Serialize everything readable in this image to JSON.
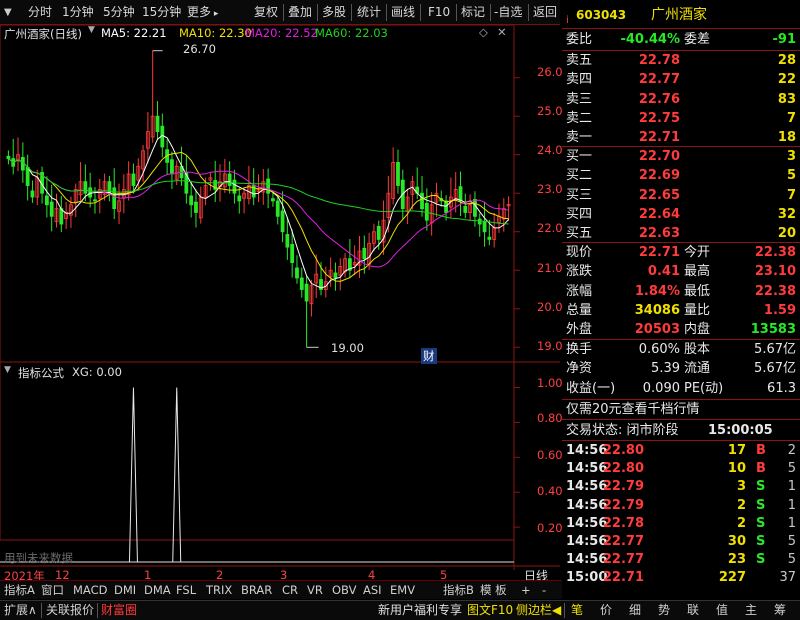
{
  "toolbar": {
    "back_icon": "down-triangle-icon",
    "timeframes": [
      "分时",
      "1分钟",
      "5分钟",
      "15分钟"
    ],
    "more": "更多",
    "more_icon": "chevron-right-icon",
    "actions": [
      "复权",
      "叠加",
      "多股",
      "统计",
      "画线",
      "F10",
      "标记",
      "-自选",
      "返回"
    ]
  },
  "chart": {
    "title": "广州酒家(日线)",
    "ma": [
      {
        "label": "MA5: 22.21",
        "color": "#ffffff"
      },
      {
        "label": "MA10: 22.30",
        "color": "#f0e000"
      },
      {
        "label": "MA20: 22.52",
        "color": "#e020e0"
      },
      {
        "label": "MA60: 22.03",
        "color": "#20d020"
      }
    ],
    "high_label": "26.70",
    "low_label": "19.00",
    "fin_badge": "财",
    "indicator_title": "指标公式",
    "indicator_value": "XG: 0.00",
    "watermark": "用到未来数据",
    "period": "日线",
    "price_ticks": [
      "26.00",
      "25.00",
      "24.00",
      "23.00",
      "22.00",
      "21.00",
      "20.00",
      "19.00"
    ],
    "ind_ticks": [
      "1.00",
      "0.80",
      "0.60",
      "0.40",
      "0.20"
    ],
    "dates": [
      "2021年",
      "12",
      "1",
      "2",
      "3",
      "4",
      "5"
    ]
  },
  "chart_data": {
    "type": "candlestick",
    "ylim": [
      18.8,
      26.9
    ],
    "closes": [
      23.9,
      23.7,
      24.0,
      23.6,
      23.2,
      22.9,
      23.4,
      23.0,
      22.7,
      22.4,
      22.6,
      22.2,
      22.5,
      22.7,
      23.1,
      23.3,
      23.0,
      22.9,
      22.8,
      23.1,
      23.3,
      23.0,
      22.6,
      22.8,
      23.1,
      23.5,
      23.2,
      23.7,
      24.1,
      24.6,
      25.0,
      24.6,
      24.2,
      23.8,
      23.5,
      23.7,
      23.4,
      23.0,
      22.7,
      22.5,
      22.9,
      23.2,
      23.4,
      23.1,
      23.3,
      23.5,
      23.2,
      23.0,
      22.8,
      23.0,
      23.2,
      22.9,
      23.1,
      23.3,
      23.0,
      22.8,
      22.4,
      22.0,
      21.6,
      21.2,
      20.8,
      20.5,
      20.2,
      20.6,
      20.9,
      20.5,
      20.7,
      21.0,
      20.8,
      21.1,
      21.3,
      21.0,
      21.2,
      21.5,
      21.3,
      21.7,
      22.0,
      21.8,
      22.3,
      23.0,
      23.8,
      23.2,
      22.6,
      22.9,
      23.3,
      23.0,
      22.6,
      22.3,
      22.7,
      23.0,
      22.8,
      22.5,
      22.9,
      23.1,
      22.8,
      22.5,
      22.7,
      22.4,
      22.2,
      22.0,
      21.8,
      22.1,
      22.4,
      22.6,
      22.71
    ],
    "signal_spikes": [
      {
        "bar": 26,
        "value": 1.0
      },
      {
        "bar": 35,
        "value": 1.0
      }
    ],
    "indicator_ylim": [
      0,
      1.1
    ]
  },
  "quote": {
    "code": "603043",
    "name": "广州酒家",
    "weibi_label": "委比",
    "weibi": "-40.44%",
    "weicha_label": "委差",
    "weicha": "-91",
    "asks": [
      {
        "label": "卖五",
        "price": "22.78",
        "vol": "28"
      },
      {
        "label": "卖四",
        "price": "22.77",
        "vol": "22"
      },
      {
        "label": "卖三",
        "price": "22.76",
        "vol": "83"
      },
      {
        "label": "卖二",
        "price": "22.75",
        "vol": "7"
      },
      {
        "label": "卖一",
        "price": "22.71",
        "vol": "18"
      }
    ],
    "bids": [
      {
        "label": "买一",
        "price": "22.70",
        "vol": "3"
      },
      {
        "label": "买二",
        "price": "22.69",
        "vol": "5"
      },
      {
        "label": "买三",
        "price": "22.65",
        "vol": "7"
      },
      {
        "label": "买四",
        "price": "22.64",
        "vol": "32"
      },
      {
        "label": "买五",
        "price": "22.63",
        "vol": "20"
      }
    ],
    "stats": [
      {
        "l1": "现价",
        "v1": "22.71",
        "c1": "red",
        "l2": "今开",
        "v2": "22.38",
        "c2": "red"
      },
      {
        "l1": "涨跌",
        "v1": "0.41",
        "c1": "red",
        "l2": "最高",
        "v2": "23.10",
        "c2": "red"
      },
      {
        "l1": "涨幅",
        "v1": "1.84%",
        "c1": "red",
        "l2": "最低",
        "v2": "22.38",
        "c2": "red"
      },
      {
        "l1": "总量",
        "v1": "34086",
        "c1": "yel",
        "l2": "量比",
        "v2": "1.59",
        "c2": "red"
      },
      {
        "l1": "外盘",
        "v1": "20503",
        "c1": "red",
        "l2": "内盘",
        "v2": "13583",
        "c2": "green"
      }
    ],
    "fin": [
      {
        "l1": "换手",
        "v1": "0.60%",
        "l2": "股本",
        "v2": "5.67亿"
      },
      {
        "l1": "净资",
        "v1": "5.39",
        "l2": "流通",
        "v2": "5.67亿"
      },
      {
        "l1": "收益(一)",
        "v1": "0.090",
        "l2": "PE(动)",
        "v2": "61.3"
      }
    ],
    "promo": "仅需20元查看千档行情",
    "trade_status": "交易状态: 闭市阶段",
    "trade_time": "15:00:05",
    "ticks": [
      {
        "t": "14:56",
        "p": "22.80",
        "v": "17",
        "d": "B",
        "n": "2",
        "pc": "red",
        "dc": "red"
      },
      {
        "t": "14:56",
        "p": "22.80",
        "v": "10",
        "d": "B",
        "n": "5",
        "pc": "red",
        "dc": "red"
      },
      {
        "t": "14:56",
        "p": "22.79",
        "v": "3",
        "d": "S",
        "n": "1",
        "pc": "red",
        "dc": "green"
      },
      {
        "t": "14:56",
        "p": "22.79",
        "v": "2",
        "d": "S",
        "n": "1",
        "pc": "red",
        "dc": "green"
      },
      {
        "t": "14:56",
        "p": "22.78",
        "v": "2",
        "d": "S",
        "n": "1",
        "pc": "red",
        "dc": "green"
      },
      {
        "t": "14:56",
        "p": "22.77",
        "v": "30",
        "d": "S",
        "n": "5",
        "pc": "red",
        "dc": "green"
      },
      {
        "t": "14:56",
        "p": "22.77",
        "v": "23",
        "d": "S",
        "n": "5",
        "pc": "red",
        "dc": "green"
      },
      {
        "t": "15:00",
        "p": "22.71",
        "v": "227",
        "d": "",
        "n": "37",
        "pc": "red",
        "dc": "red"
      }
    ]
  },
  "tabs": {
    "left": [
      "指标A",
      "窗口",
      "MACD",
      "DMI",
      "DMA",
      "FSL",
      "TRIX",
      "BRAR",
      "CR",
      "VR",
      "OBV",
      "ASI",
      "EMV"
    ],
    "right": [
      "指标B",
      "模 板",
      "+",
      "-"
    ]
  },
  "status": {
    "left": [
      "扩展∧",
      "关联报价",
      "财富圈"
    ],
    "promo": "新用户福利专享",
    "right": [
      "图文F10",
      "侧边栏◀"
    ],
    "icons": [
      "笔",
      "价",
      "细",
      "势",
      "联",
      "值",
      "主",
      "筹"
    ]
  },
  "colors": {
    "up": "#ff3b3b",
    "down": "#27e827",
    "ma5": "#ffffff",
    "ma10": "#f0e000",
    "ma20": "#e020e0",
    "ma60": "#20d020",
    "border": "#8a1414"
  }
}
